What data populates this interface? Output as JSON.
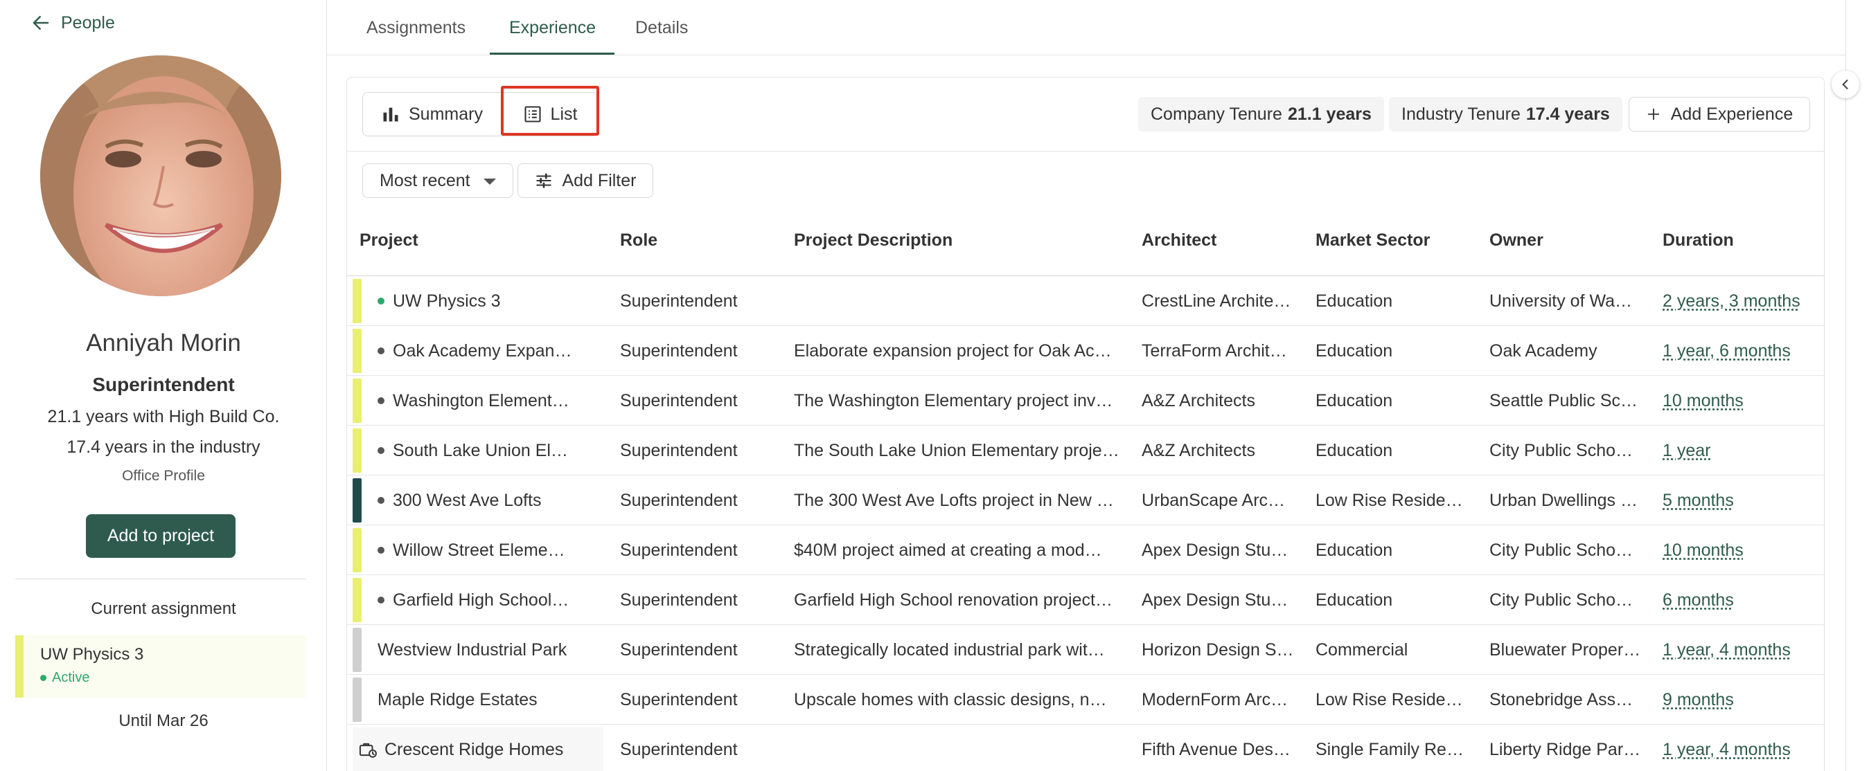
{
  "sidebar": {
    "back_label": "People",
    "name": "Anniyah Morin",
    "role": "Superintendent",
    "company_years": "21.1 years with High Build Co.",
    "industry_years": "17.4 years in the industry",
    "office_profile": "Office Profile",
    "add_button": "Add to project",
    "current_title": "Current assignment",
    "assignment_name": "UW Physics 3",
    "assignment_status": "Active",
    "until": "Until Mar 26"
  },
  "tabs": [
    {
      "label": "Assignments"
    },
    {
      "label": "Experience"
    },
    {
      "label": "Details"
    }
  ],
  "toolbar": {
    "summary_label": "Summary",
    "list_label": "List",
    "company_tenure_label": "Company Tenure",
    "company_tenure_value": "21.1 years",
    "industry_tenure_label": "Industry Tenure",
    "industry_tenure_value": "17.4 years",
    "add_experience_label": "Add Experience"
  },
  "filters": {
    "sort_value": "Most recent",
    "add_filter_label": "Add Filter"
  },
  "table": {
    "columns": [
      "Project",
      "Role",
      "Project Description",
      "Architect",
      "Market Sector",
      "Owner",
      "Duration"
    ],
    "rows": [
      {
        "project": "UW Physics 3",
        "role": "Superintendent",
        "description": "",
        "architect": "CrestLine Archite…",
        "sector": "Education",
        "owner": "University of Wa…",
        "duration": "2 years, 3 months"
      },
      {
        "project": "Oak Academy Expan…",
        "role": "Superintendent",
        "description": "Elaborate expansion project for Oak Ac…",
        "architect": "TerraForm Archit…",
        "sector": "Education",
        "owner": "Oak Academy",
        "duration": "1 year, 6 months"
      },
      {
        "project": "Washington Element…",
        "role": "Superintendent",
        "description": "The Washington Elementary project inv…",
        "architect": "A&Z Architects",
        "sector": "Education",
        "owner": "Seattle Public Sc…",
        "duration": "10 months"
      },
      {
        "project": "South Lake Union El…",
        "role": "Superintendent",
        "description": "The South Lake Union Elementary proje…",
        "architect": "A&Z Architects",
        "sector": "Education",
        "owner": "City Public Scho…",
        "duration": "1 year"
      },
      {
        "project": "300 West Ave Lofts",
        "role": "Superintendent",
        "description": "The 300 West Ave Lofts project in New …",
        "architect": "UrbanScape Arc…",
        "sector": "Low Rise Reside…",
        "owner": "Urban Dwellings …",
        "duration": "5 months"
      },
      {
        "project": "Willow Street Eleme…",
        "role": "Superintendent",
        "description": "$40M project aimed at creating a mod…",
        "architect": "Apex Design Stu…",
        "sector": "Education",
        "owner": "City Public Scho…",
        "duration": "10 months"
      },
      {
        "project": "Garfield High School…",
        "role": "Superintendent",
        "description": "Garfield High School renovation project…",
        "architect": "Apex Design Stu…",
        "sector": "Education",
        "owner": "City Public Scho…",
        "duration": "6 months"
      },
      {
        "project": "Westview Industrial Park",
        "role": "Superintendent",
        "description": "Strategically located industrial park wit…",
        "architect": "Horizon Design S…",
        "sector": "Commercial",
        "owner": "Bluewater Proper…",
        "duration": "1 year, 4 months"
      },
      {
        "project": "Maple Ridge Estates",
        "role": "Superintendent",
        "description": "Upscale homes with classic designs, n…",
        "architect": "ModernForm Arc…",
        "sector": "Low Rise Reside…",
        "owner": "Stonebridge Ass…",
        "duration": "9 months"
      },
      {
        "project": "Crescent Ridge Homes",
        "role": "Superintendent",
        "description": "",
        "architect": "Fifth Avenue Des…",
        "sector": "Single Family Re…",
        "owner": "Liberty Ridge Par…",
        "duration": "1 year, 4 months"
      }
    ]
  },
  "colors": {
    "accent": "#2e5b4d",
    "active_green": "#2ea86b",
    "education_bar": "#e9ef71",
    "residential_bar": "#1f4a4a",
    "other_bar": "#cfcfcf",
    "highlight": "#e03524"
  },
  "icons": {
    "back": "arrow-left-icon",
    "summary": "bar-chart-icon",
    "list": "list-icon",
    "add": "plus-icon",
    "filter": "sliders-icon",
    "collapse": "chevron-left-icon",
    "project": "briefcase-clock-icon"
  }
}
